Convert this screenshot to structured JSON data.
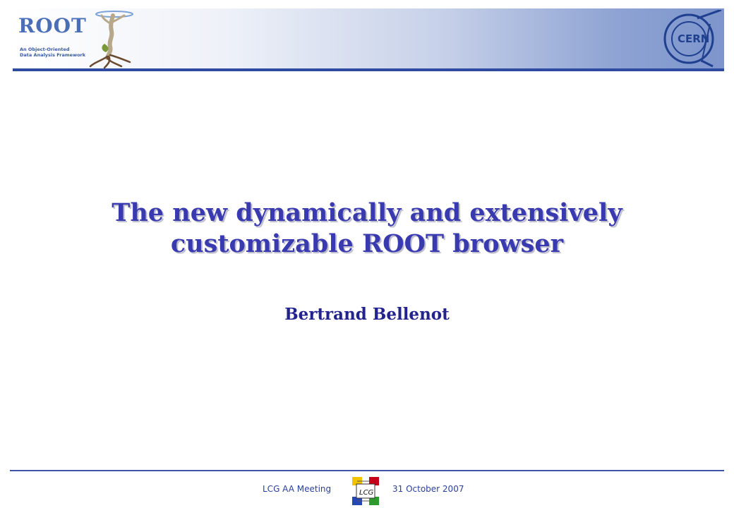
{
  "header": {
    "root_logo": {
      "wordmark": "ROOT",
      "tagline_line1": "An Object-Oriented",
      "tagline_line2": "Data Analysis Framework",
      "icon": "root-statue-figure"
    },
    "cern_logo": {
      "text": "CERN",
      "icon": "cern-logo"
    },
    "colors": {
      "band_start": "#ffffff",
      "band_end": "#7d95cc",
      "rule": "#2f4aa1"
    }
  },
  "slide": {
    "title_line1": "The new dynamically and extensively",
    "title_line2": "customizable ROOT browser",
    "author": "Bertrand Bellenot",
    "colors": {
      "title": "#3a3ab0",
      "author": "#23238f"
    }
  },
  "footer": {
    "left_text": "LCG AA Meeting",
    "right_text": "31 October 2007",
    "logo": {
      "text": "LCG",
      "icon": "lcg-logo",
      "colors": [
        "#f2c400",
        "#c4001a",
        "#2447b5",
        "#2c9a2c"
      ]
    }
  }
}
